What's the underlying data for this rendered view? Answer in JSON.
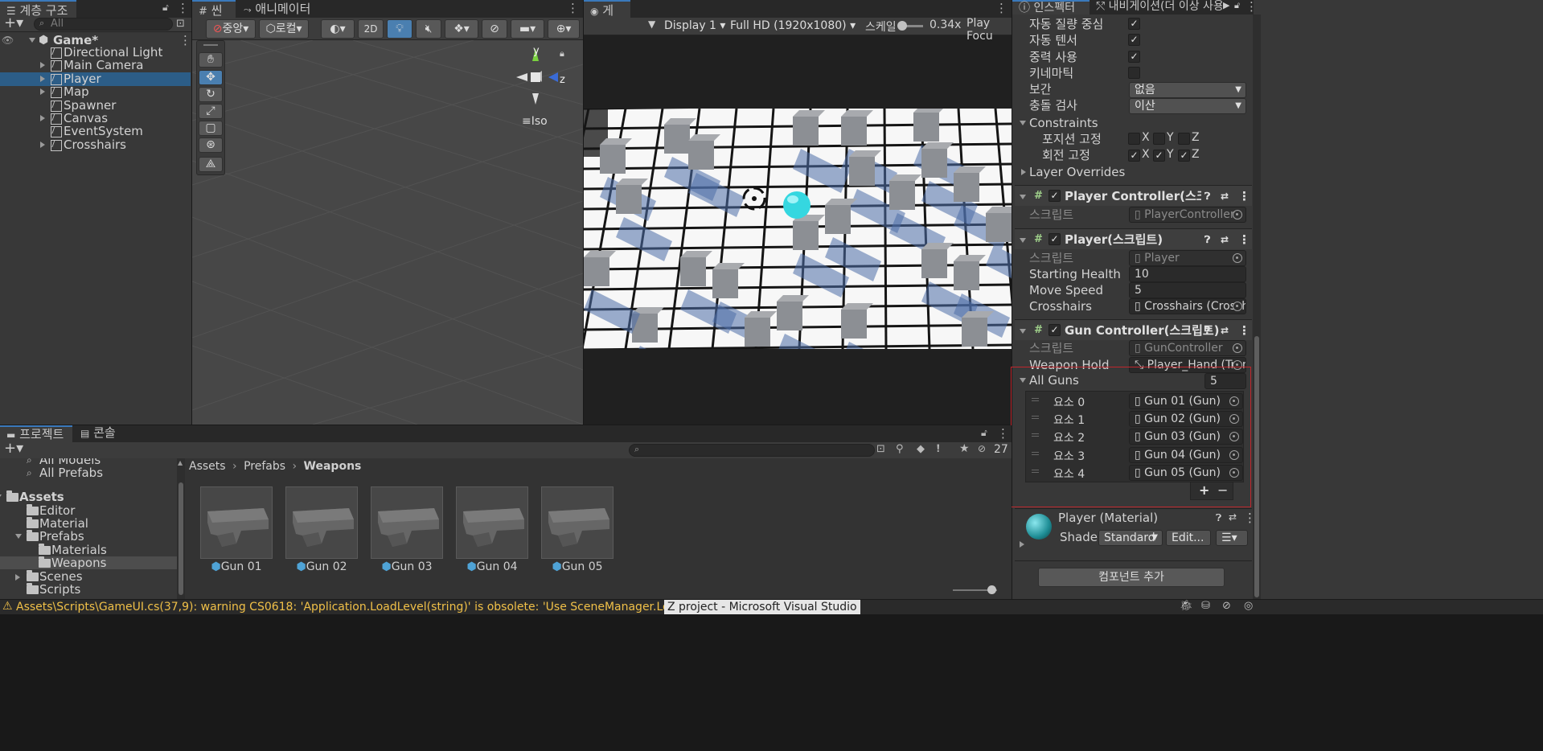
{
  "hierarchy": {
    "tab_label": "계층 구조",
    "search_placeholder": "All",
    "scene_name": "Game*",
    "items": [
      {
        "label": "Directional Light",
        "expandable": false
      },
      {
        "label": "Main Camera",
        "expandable": true
      },
      {
        "label": "Player",
        "expandable": true,
        "selected": true
      },
      {
        "label": "Map",
        "expandable": true
      },
      {
        "label": "Spawner",
        "expandable": false
      },
      {
        "label": "Canvas",
        "expandable": true
      },
      {
        "label": "EventSystem",
        "expandable": false
      },
      {
        "label": "Crosshairs",
        "expandable": true
      }
    ]
  },
  "scene_view": {
    "tab_scene": "씬",
    "tab_animator": "애니메이터",
    "pivot_label": "중앙",
    "space_label": "로컬",
    "mode_2d": "2D",
    "projection_label": "Iso",
    "gizmo_y": "y",
    "gizmo_z": "z"
  },
  "game_view": {
    "tab_label": "게임",
    "display": "Display 1",
    "resolution": "Full HD (1920x1080)",
    "scale_label": "스케일",
    "scale_value": "0.34x",
    "play_focus": "Play Focu"
  },
  "inspector": {
    "tab_inspector": "인스펙터",
    "tab_navigation": "내비게이션(더 이상 사용",
    "rigidbody_rows": [
      {
        "label": "자동 질량 중심",
        "checked": true
      },
      {
        "label": "자동 텐서",
        "checked": true
      },
      {
        "label": "중력 사용",
        "checked": true
      },
      {
        "label": "키네마틱",
        "checked": false
      }
    ],
    "interpolate_label": "보간",
    "interpolate_value": "없음",
    "collision_label": "충돌 검사",
    "collision_value": "이산",
    "constraints_label": "Constraints",
    "freeze_position_label": "포지션 고정",
    "freeze_rotation_label": "회전 고정",
    "axis_x": "X",
    "axis_y": "Y",
    "axis_z": "Z",
    "layer_overrides": "Layer Overrides",
    "script_label": "스크립트",
    "player_controller": {
      "title": "Player Controller(스크립트",
      "script": "PlayerController"
    },
    "player": {
      "title": "Player(스크립트)",
      "script": "Player",
      "starting_health_label": "Starting Health",
      "starting_health": "10",
      "move_speed_label": "Move Speed",
      "move_speed": "5",
      "crosshairs_label": "Crosshairs",
      "crosshairs": "Crosshairs (Crossh"
    },
    "gun_controller": {
      "title": "Gun Controller(스크립트)",
      "script": "GunController",
      "weapon_hold_label": "Weapon Hold",
      "weapon_hold": "Player_Hand (Trans",
      "all_guns_label": "All Guns",
      "all_guns_count": "5",
      "elements": [
        {
          "label": "요소 0",
          "value": "Gun 01 (Gun)"
        },
        {
          "label": "요소 1",
          "value": "Gun 02 (Gun)"
        },
        {
          "label": "요소 2",
          "value": "Gun 03 (Gun)"
        },
        {
          "label": "요소 3",
          "value": "Gun 04 (Gun)"
        },
        {
          "label": "요소 4",
          "value": "Gun 05 (Gun)"
        }
      ],
      "add": "+",
      "remove": "−"
    },
    "material": {
      "title": "Player (Material)",
      "shader_label": "Shader",
      "shader_value": "Standard",
      "edit_label": "Edit..."
    },
    "add_component": "컴포넌트 추가"
  },
  "project": {
    "tab_project": "프로젝트",
    "tab_console": "콘솔",
    "hidden_count": "27",
    "breadcrumb": [
      "Assets",
      "Prefabs",
      "Weapons"
    ],
    "tree": [
      {
        "label": "All Models",
        "indent": 1,
        "kind": "search"
      },
      {
        "label": "All Prefabs",
        "indent": 1,
        "kind": "search"
      },
      {
        "label": "Assets",
        "indent": 0,
        "kind": "folder",
        "bold": true
      },
      {
        "label": "Editor",
        "indent": 1,
        "kind": "folder"
      },
      {
        "label": "Material",
        "indent": 1,
        "kind": "folder"
      },
      {
        "label": "Prefabs",
        "indent": 1,
        "kind": "folder"
      },
      {
        "label": "Materials",
        "indent": 2,
        "kind": "folder"
      },
      {
        "label": "Weapons",
        "indent": 2,
        "kind": "folder",
        "selected": true
      },
      {
        "label": "Scenes",
        "indent": 1,
        "kind": "folder"
      },
      {
        "label": "Scripts",
        "indent": 1,
        "kind": "folder"
      }
    ],
    "assets": [
      "Gun 01",
      "Gun 02",
      "Gun 03",
      "Gun 04",
      "Gun 05"
    ]
  },
  "status_bar": {
    "warning": "Assets\\Scripts\\GameUI.cs(37,9): warning CS0618: 'Application.LoadLevel(string)' is obsolete: 'Use SceneManager.LoadScene'",
    "taskbar_hint": "Z project - Microsoft Visual Studio"
  },
  "colors": {
    "selection": "#2c5d87",
    "highlight_border": "#c0272d",
    "warning_text": "#f0c048",
    "player_sphere": "#35d7e0"
  }
}
